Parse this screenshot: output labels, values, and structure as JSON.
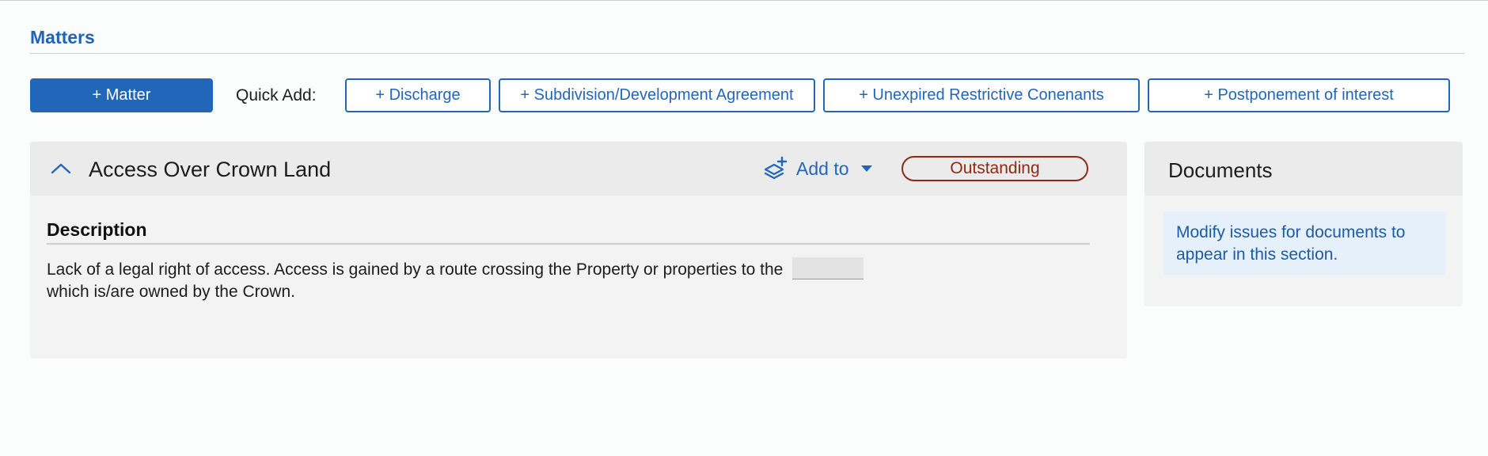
{
  "section": {
    "title": "Matters"
  },
  "toolbar": {
    "add_matter_label": "+ Matter",
    "quick_add_label": "Quick Add:",
    "quick_add_buttons": [
      "+ Discharge",
      "+ Subdivision/Development Agreement",
      "+ Unexpired Restrictive Conenants",
      "+ Postponement of interest"
    ]
  },
  "matter": {
    "title": "Access Over Crown Land",
    "add_to_label": "Add to",
    "status": "Outstanding",
    "description_heading": "Description",
    "description_part1": "Lack of a legal right of access. Access is gained by a route crossing the Property or properties to the",
    "description_part2": "which is/are owned by the Crown."
  },
  "documents": {
    "title": "Documents",
    "info": "Modify issues for documents to appear in this section."
  },
  "icons": {
    "collapse": "chevron-up-icon",
    "add_to": "layers-plus-icon",
    "dropdown": "caret-down-icon"
  },
  "colors": {
    "accent": "#2266ba",
    "status": "#8d2a14",
    "info_background": "#e6f0fb"
  }
}
